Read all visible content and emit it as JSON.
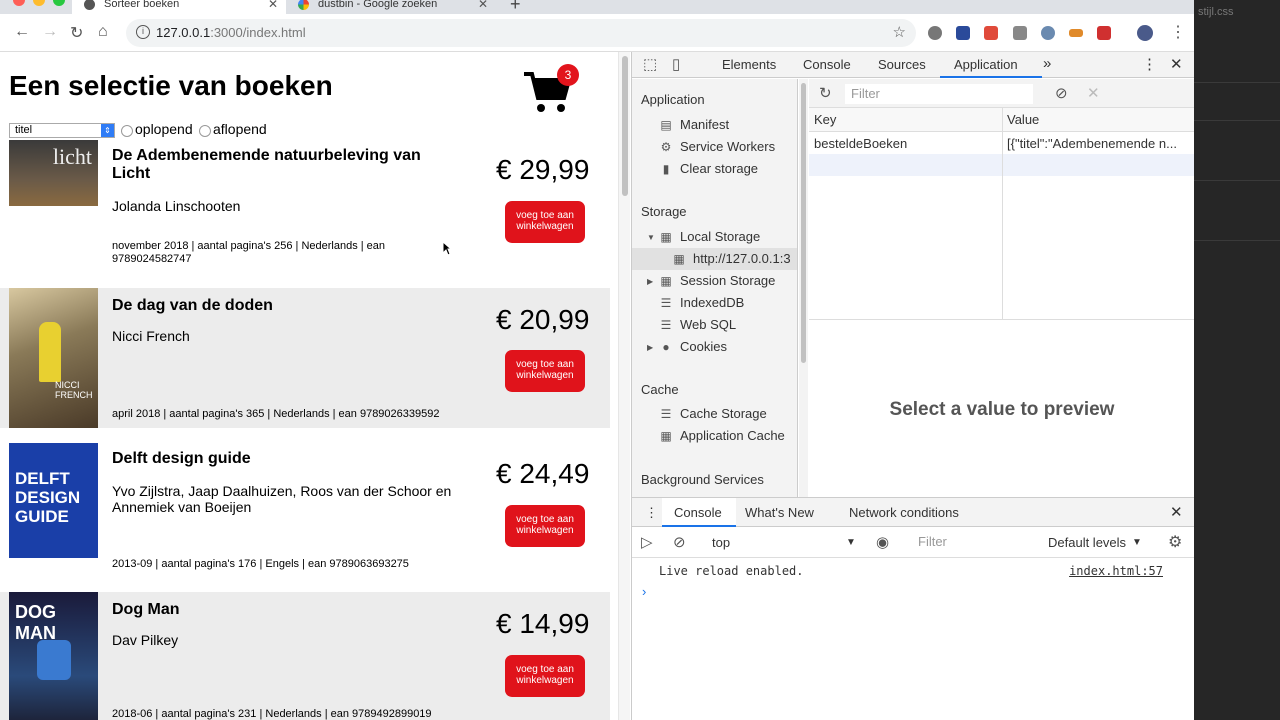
{
  "browser": {
    "tabs": [
      {
        "label": "Sorteer boeken",
        "active": true
      },
      {
        "label": "dustbin - Google zoeken",
        "active": false
      }
    ],
    "url_host": "127.0.0.1",
    "url_path": ":3000/index.html"
  },
  "page": {
    "title": "Een selectie van boeken",
    "cart_count": "3",
    "sort": {
      "selected": "titel",
      "options": [
        "oplopend",
        "aflopend"
      ]
    },
    "books": [
      {
        "title": "De Adembenemende natuurbeleving van Licht",
        "author": "Jolanda Linschooten",
        "meta": "november 2018 | aantal pagina's 256 | Nederlands | ean 9789024582747",
        "price": "€ 29,99",
        "button": "voeg toe aan winkelwagen",
        "cover_colors": [
          "#5a4a3a",
          "#8a6a4a"
        ],
        "cover_text": "licht"
      },
      {
        "title": "De dag van de doden",
        "author": "Nicci French",
        "meta": "april 2018 | aantal pagina's 365 | Nederlands | ean 9789026339592",
        "price": "€ 20,99",
        "button": "voeg toe aan winkelwagen",
        "cover_colors": [
          "#b8a070",
          "#e8d040"
        ],
        "cover_text": "NICCI FRENCH"
      },
      {
        "title": "Delft design guide",
        "author": "Yvo Zijlstra, Jaap Daalhuizen, Roos van der Schoor en Annemiek van Boeijen",
        "meta": "2013-09 | aantal pagina's 176 | Engels | ean 9789063693275",
        "price": "€ 24,49",
        "button": "voeg toe aan winkelwagen",
        "cover_colors": [
          "#1a3fa8",
          "#1a3fa8"
        ],
        "cover_text": "DELFT DESIGN GUIDE"
      },
      {
        "title": "Dog Man",
        "author": "Dav Pilkey",
        "meta": "2018-06 | aantal pagina's 231 | Nederlands | ean 9789492899019",
        "price": "€ 14,99",
        "button": "voeg toe aan winkelwagen",
        "cover_colors": [
          "#1a1a3a",
          "#3a6ab0"
        ],
        "cover_text": "DOG MAN"
      }
    ]
  },
  "devtools": {
    "tabs": [
      "Elements",
      "Console",
      "Sources",
      "Application"
    ],
    "active_tab": "Application",
    "sidebar": {
      "application_header": "Application",
      "application_items": [
        "Manifest",
        "Service Workers",
        "Clear storage"
      ],
      "storage_header": "Storage",
      "local_storage": "Local Storage",
      "local_storage_child": "http://127.0.0.1:3",
      "storage_items": [
        "Session Storage",
        "IndexedDB",
        "Web SQL",
        "Cookies"
      ],
      "cache_header": "Cache",
      "cache_items": [
        "Cache Storage",
        "Application Cache"
      ],
      "bg_header": "Background Services"
    },
    "filter_placeholder": "Filter",
    "table": {
      "key_header": "Key",
      "value_header": "Value",
      "row_key": "besteldeBoeken",
      "row_value": "[{\"titel\":\"Adembenemende n..."
    },
    "preview_text": "Select a value to preview",
    "drawer": {
      "tabs": [
        "Console",
        "What's New",
        "Network conditions"
      ],
      "context": "top",
      "filter_placeholder": "Filter",
      "levels": "Default levels",
      "log_message": "Live reload enabled.",
      "log_source": "index.html:57",
      "prompt": "›"
    }
  },
  "background": {
    "file_label": "stijl.css"
  }
}
